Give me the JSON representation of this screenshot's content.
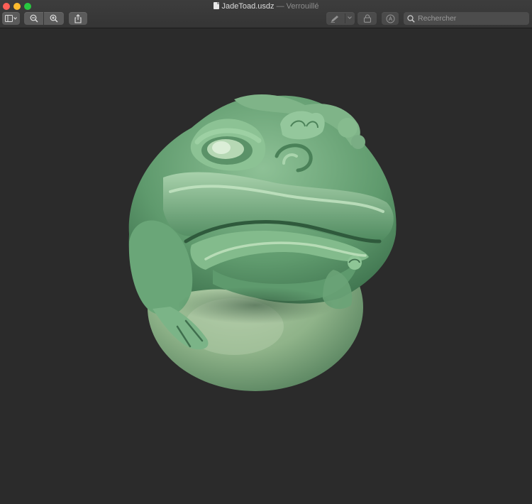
{
  "window": {
    "title": {
      "filename": "JadeToad.usdz",
      "separator": "—",
      "status": "Verrouillé"
    }
  },
  "toolbar": {
    "sidebar_icon": "sidebar-toggle-icon",
    "zoom_out_icon": "zoom-out-icon",
    "zoom_in_icon": "zoom-in-icon",
    "share_icon": "share-icon",
    "markup_icon": "pen-markup-icon",
    "lock_icon": "lock-icon",
    "annotate_icon": "annotate-circle-icon",
    "search": {
      "placeholder": "Rechercher",
      "value": ""
    }
  },
  "colors": {
    "traffic_close": "#fe5f57",
    "traffic_minimize": "#febc2e",
    "traffic_maximize": "#28c840",
    "viewport_bg": "#2b2b2b",
    "jade": "#6fa47a"
  }
}
